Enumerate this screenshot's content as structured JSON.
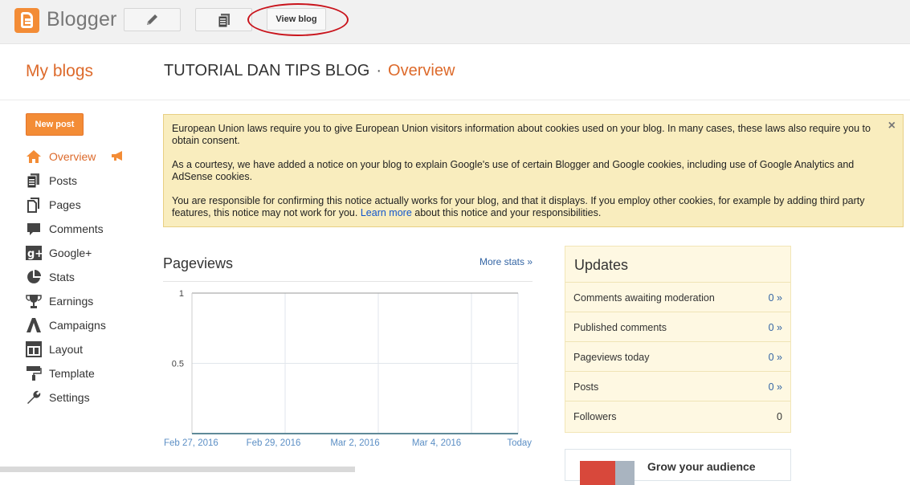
{
  "topbar": {
    "app_name": "Blogger",
    "view_blog_label": "View blog"
  },
  "header": {
    "my_blogs": "My blogs",
    "blog_title": "TUTORIAL DAN TIPS BLOG",
    "separator": "·",
    "section": "Overview"
  },
  "sidebar": {
    "new_post": "New post",
    "items": [
      {
        "label": "Overview",
        "icon": "home-icon",
        "active": true
      },
      {
        "label": "Posts",
        "icon": "posts-icon"
      },
      {
        "label": "Pages",
        "icon": "pages-icon"
      },
      {
        "label": "Comments",
        "icon": "comments-icon"
      },
      {
        "label": "Google+",
        "icon": "google-plus-icon"
      },
      {
        "label": "Stats",
        "icon": "stats-icon"
      },
      {
        "label": "Earnings",
        "icon": "trophy-icon"
      },
      {
        "label": "Campaigns",
        "icon": "campaigns-icon"
      },
      {
        "label": "Layout",
        "icon": "layout-icon"
      },
      {
        "label": "Template",
        "icon": "template-icon"
      },
      {
        "label": "Settings",
        "icon": "wrench-icon"
      }
    ]
  },
  "notice": {
    "p1": "European Union laws require you to give European Union visitors information about cookies used on your blog. In many cases, these laws also require you to obtain consent.",
    "p2": "As a courtesy, we have added a notice on your blog to explain Google's use of certain Blogger and Google cookies, including use of Google Analytics and AdSense cookies.",
    "p3_before": "You are responsible for confirming this notice actually works for your blog, and that it displays. If you employ other cookies, for example by adding third party features, this notice may not work for you.",
    "p3_link": "Learn more",
    "p3_after": "about this notice and your responsibilities.",
    "close": "×"
  },
  "pageviews": {
    "title": "Pageviews",
    "more_stats": "More stats »"
  },
  "chart_data": {
    "type": "line",
    "x": [
      "Feb 27, 2016",
      "Feb 29, 2016",
      "Mar 2, 2016",
      "Mar 4, 2016",
      "Today"
    ],
    "series": [
      {
        "values": [
          0,
          0,
          0,
          0,
          0
        ]
      }
    ],
    "yticks": [
      "1",
      "0.5"
    ],
    "ylim": [
      0,
      1
    ],
    "grid": true,
    "line_color": "#5f8a98"
  },
  "updates": {
    "title": "Updates",
    "rows": [
      {
        "label": "Comments awaiting moderation",
        "value": "0 »"
      },
      {
        "label": "Published comments",
        "value": "0 »"
      },
      {
        "label": "Pageviews today",
        "value": "0 »"
      },
      {
        "label": "Posts",
        "value": "0 »"
      },
      {
        "label": "Followers",
        "value": "0"
      }
    ]
  },
  "grow": {
    "title": "Grow your audience"
  },
  "colors": {
    "accent": "#dd6a2b",
    "brand_orange": "#f38c36",
    "link": "#3465a4",
    "notice_bg": "#f9edbe"
  }
}
